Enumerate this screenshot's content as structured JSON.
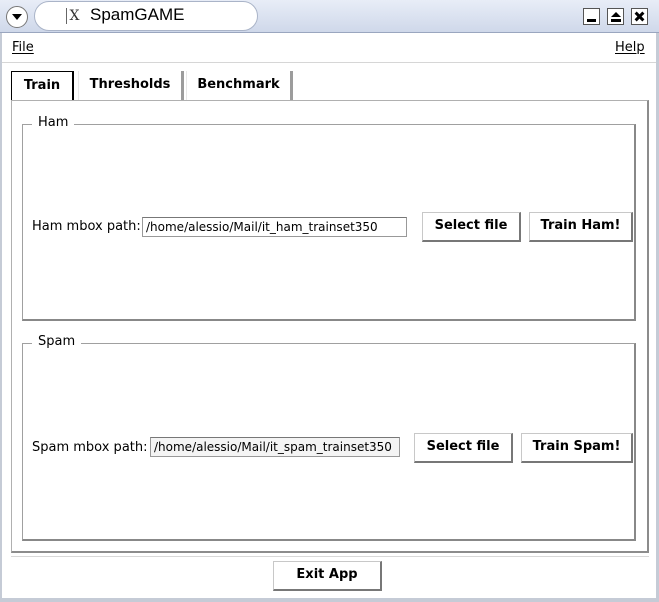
{
  "window": {
    "title": "SpamGAME",
    "icon": "x-app-icon",
    "controls": [
      "window-menu-icon",
      "minimize-icon",
      "maximize-icon",
      "close-icon"
    ]
  },
  "menu": {
    "file": "File",
    "help": "Help"
  },
  "tabs": [
    {
      "label": "Train",
      "selected": true
    },
    {
      "label": "Thresholds",
      "selected": false
    },
    {
      "label": "Benchmark",
      "selected": false
    }
  ],
  "ham": {
    "title": "Ham",
    "path_label": "Ham mbox path:",
    "path_value": "/home/alessio/Mail/it_ham_trainset350",
    "select_label": "Select file",
    "train_label": "Train Ham!"
  },
  "spam": {
    "title": "Spam",
    "path_label": "Spam mbox path:",
    "path_value": "/home/alessio/Mail/it_spam_trainset350",
    "select_label": "Select file",
    "train_label": "Train Spam!"
  },
  "footer": {
    "exit_label": "Exit App"
  }
}
